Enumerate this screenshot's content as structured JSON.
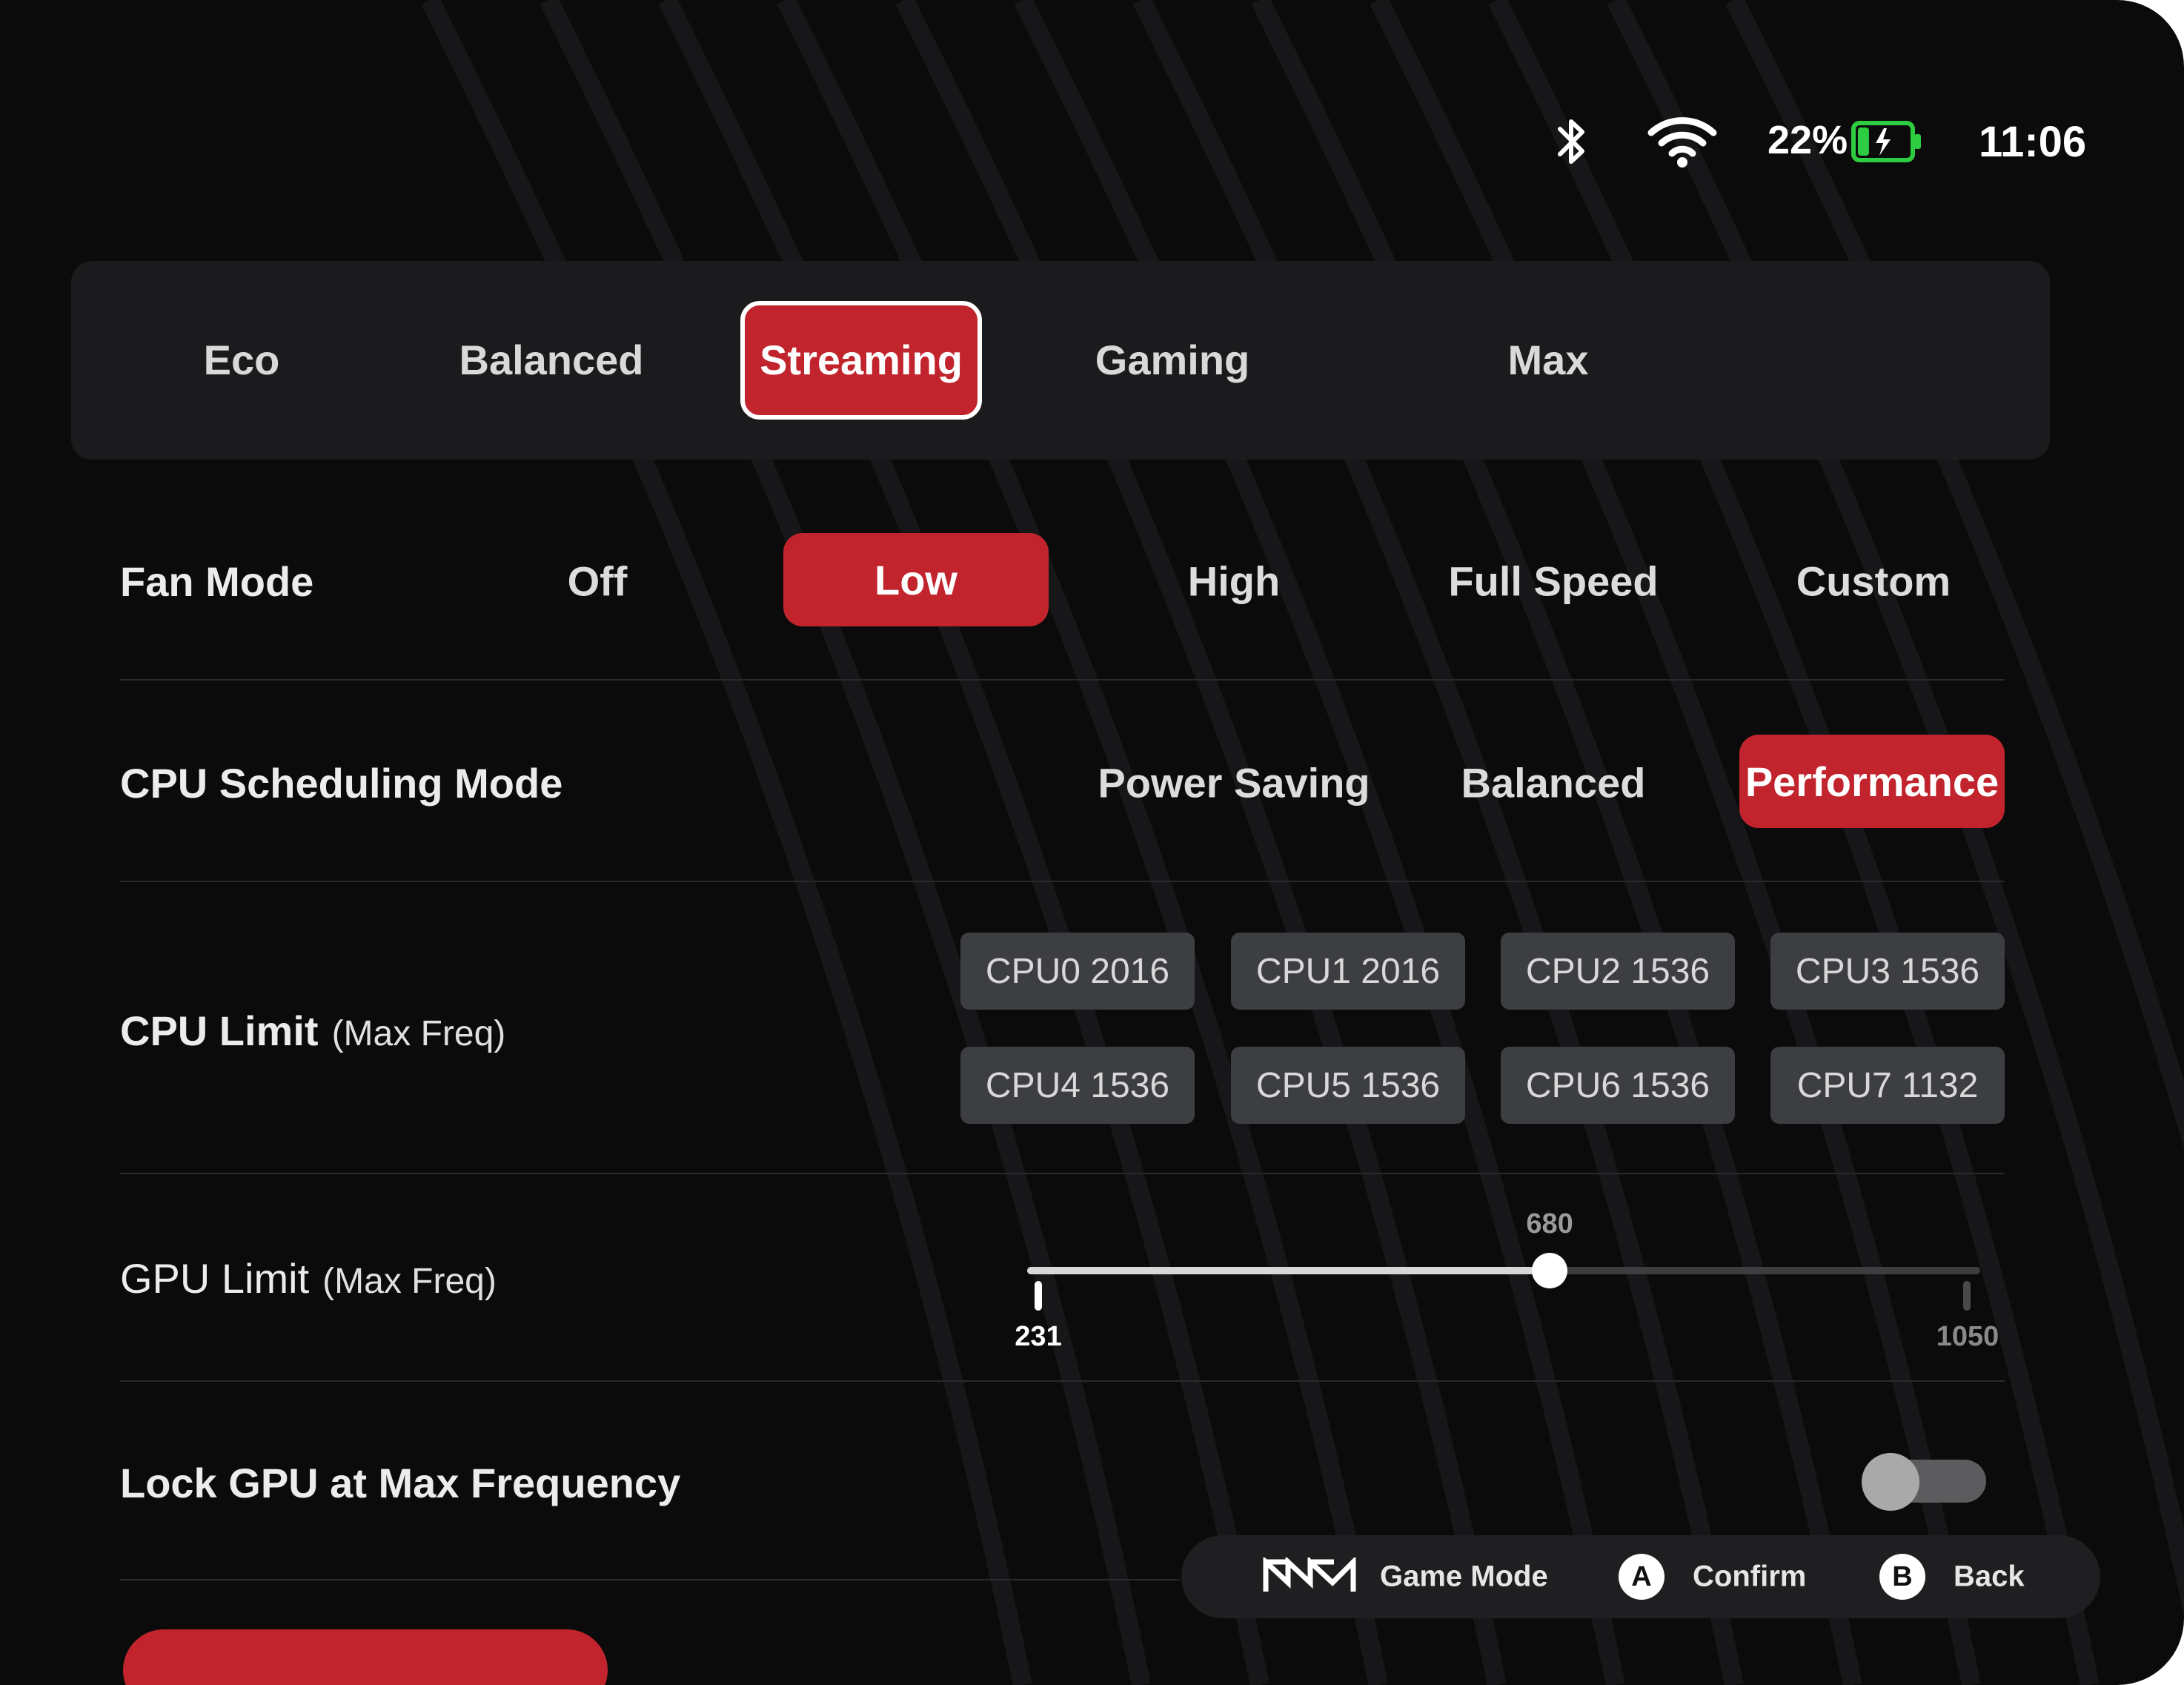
{
  "status_bar": {
    "battery_percent": "22%",
    "battery_level": 0.22,
    "battery_color": "#2ecc40",
    "charging": true,
    "time": "11:06",
    "icons": [
      "bluetooth-icon",
      "wifi-icon",
      "battery-charging-icon"
    ]
  },
  "profiles": {
    "tabs": [
      {
        "label": "Eco"
      },
      {
        "label": "Balanced"
      },
      {
        "label": "Streaming"
      },
      {
        "label": "Gaming"
      },
      {
        "label": "Max"
      }
    ],
    "selected": "Streaming"
  },
  "fan_mode": {
    "label": "Fan Mode",
    "options": [
      "Off",
      "Low",
      "High",
      "Full Speed",
      "Custom"
    ],
    "selected": "Low"
  },
  "cpu_scheduling": {
    "label": "CPU Scheduling Mode",
    "options": [
      "Power Saving",
      "Balanced",
      "Performance"
    ],
    "selected": "Performance"
  },
  "cpu_limit": {
    "label": "CPU Limit",
    "sublabel": "(Max Freq)",
    "chips": [
      "CPU0 2016",
      "CPU1 2016",
      "CPU2 1536",
      "CPU3 1536",
      "CPU4 1536",
      "CPU5 1536",
      "CPU6 1536",
      "CPU7 1132"
    ]
  },
  "gpu_limit": {
    "label": "GPU Limit",
    "sublabel": "(Max Freq)",
    "min": 231,
    "max": 1050,
    "value": 680,
    "min_label": "231",
    "max_label": "1050",
    "value_label": "680"
  },
  "lock_gpu": {
    "label": "Lock GPU at Max Frequency",
    "enabled": false
  },
  "footer": {
    "game_mode": "Game Mode",
    "confirm_key": "A",
    "confirm": "Confirm",
    "back_key": "B",
    "back": "Back"
  },
  "colors": {
    "accent": "#c1242c",
    "background": "#0b0b0c",
    "panel": "#1b1b1d"
  }
}
